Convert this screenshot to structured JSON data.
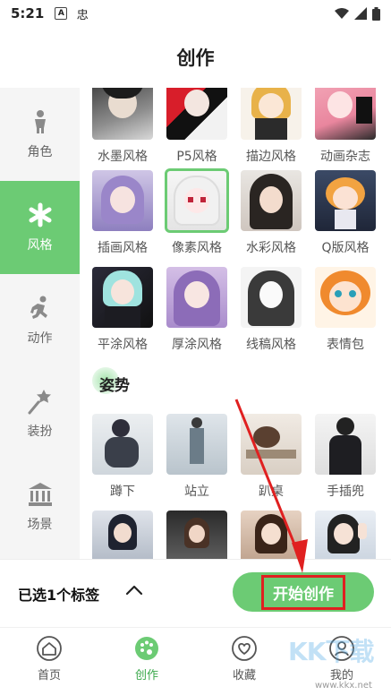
{
  "status": {
    "time": "5:21",
    "icon_a": "A",
    "icon_b": "忠"
  },
  "header": {
    "title": "创作"
  },
  "sidebar": {
    "items": [
      {
        "label": "角色",
        "icon": "person-icon"
      },
      {
        "label": "风格",
        "icon": "asterisk-icon"
      },
      {
        "label": "动作",
        "icon": "running-icon"
      },
      {
        "label": "装扮",
        "icon": "wand-icon"
      },
      {
        "label": "场景",
        "icon": "building-icon"
      }
    ]
  },
  "styles": {
    "row1": [
      "水墨风格",
      "P5风格",
      "描边风格",
      "动画杂志"
    ],
    "row2": [
      "插画风格",
      "像素风格",
      "水彩风格",
      "Q版风格"
    ],
    "row3": [
      "平涂风格",
      "厚涂风格",
      "线稿风格",
      "表情包"
    ]
  },
  "pose": {
    "title": "姿势",
    "row1": [
      "蹲下",
      "站立",
      "趴桌",
      "手插兜"
    ]
  },
  "bottom": {
    "selected_text": "已选1个标签",
    "start_label": "开始创作"
  },
  "tabs": [
    {
      "label": "首页"
    },
    {
      "label": "创作"
    },
    {
      "label": "收藏"
    },
    {
      "label": "我的"
    }
  ],
  "watermark": {
    "text": "KK下载",
    "url": "www.kkx.net"
  },
  "colors": {
    "accent": "#6ccb74",
    "highlight": "#e02020"
  }
}
